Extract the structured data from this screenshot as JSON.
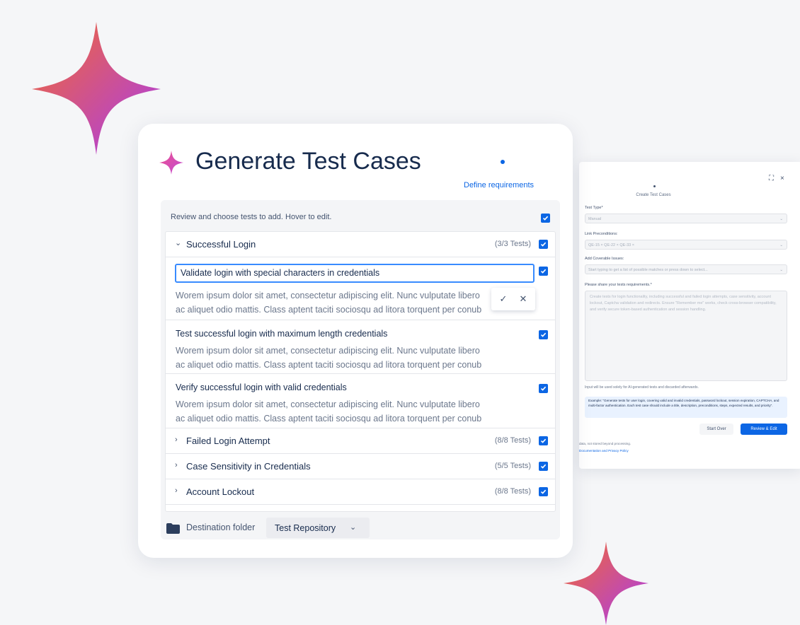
{
  "colors": {
    "accent": "#0c66e4",
    "sparkle_start": "#f0703a",
    "sparkle_end": "#b43df0"
  },
  "main": {
    "title": "Generate Test Cases",
    "step_label": "Define requirements",
    "intro": "Review and choose tests to add. Hover to edit.",
    "groups": [
      {
        "name": "Successful Login",
        "count": "(3/3 Tests)",
        "expanded": true
      },
      {
        "name": "Failed Login Attempt",
        "count": "(8/8 Tests)",
        "expanded": false
      },
      {
        "name": "Case Sensitivity in Credentials",
        "count": "(5/5 Tests)",
        "expanded": false
      },
      {
        "name": "Account Lockout",
        "count": "(8/8 Tests)",
        "expanded": false
      }
    ],
    "tests": [
      {
        "title": "Validate login with special characters in credentials",
        "desc_1": "Worem ipsum dolor sit amet, consectetur adipiscing elit. Nunc vulputate libero",
        "desc_2": "ac aliquet odio mattis. Class aptent taciti sociosqu ad litora torquent per conub"
      },
      {
        "title": "Test successful login with maximum length credentials",
        "desc_1": "Worem ipsum dolor sit amet, consectetur adipiscing elit. Nunc vulputate libero",
        "desc_2": "ac aliquet odio mattis. Class aptent taciti sociosqu ad litora torquent per conub"
      },
      {
        "title": "Verify successful login with valid credentials",
        "desc_1": "Worem ipsum dolor sit amet, consectetur adipiscing elit. Nunc vulputate libero",
        "desc_2": "ac aliquet odio mattis. Class aptent taciti sociosqu ad litora torquent per conub"
      }
    ],
    "destination_label": "Destination folder",
    "destination_value": "Test Repository"
  },
  "back": {
    "title": "Create Test Cases",
    "test_type_label": "Test Type*",
    "test_type_value": "Manual",
    "link_label": "Link Preconditions:",
    "link_value": "QE-15 ×   QE-22 ×   QE-33 ×",
    "issues_label": "Add Coverable Issues:",
    "issues_placeholder": "Start typing to get a list of possible matches or press down to select...",
    "requirements_label": "Please share your tests requirements.*",
    "requirements_text": "Create tests for login functionality, including successful and failed login attempts, case sensitivity, account lockout, Captcha validation and redirects. Ensure \"Remember me\" works, check cross-browser compatibility, and verify secure token-based authentication and session handling.",
    "hint": "Input will be used solely for AI-generated tests and discarded afterwards.",
    "example": "Example: \"Generate tests for user login, covering valid and invalid credentials, password lockout, session expiration, CAPTCHA, and multi-factor authentication. Each test case should include a title, description, preconditions, steps, expected results, and priority\".",
    "start_over": "Start Over",
    "review_edit": "Review & Edit",
    "footer_1": "data, not stored beyond processing.",
    "footer_2": "Documentation and Privacy Policy"
  }
}
